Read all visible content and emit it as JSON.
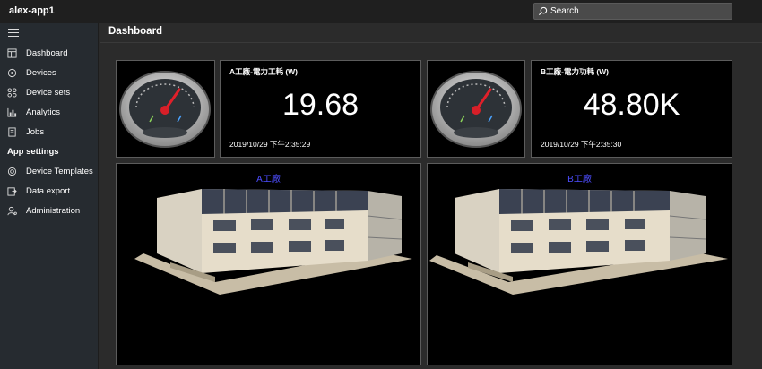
{
  "app": {
    "name": "alex-app1"
  },
  "search": {
    "placeholder": "Search"
  },
  "sidebar": {
    "items": [
      {
        "label": "Dashboard",
        "icon": "dashboard-icon"
      },
      {
        "label": "Devices",
        "icon": "devices-icon"
      },
      {
        "label": "Device sets",
        "icon": "device-sets-icon"
      },
      {
        "label": "Analytics",
        "icon": "analytics-icon"
      },
      {
        "label": "Jobs",
        "icon": "jobs-icon"
      }
    ],
    "section_heading": "App settings",
    "settings_items": [
      {
        "label": "Device Templates",
        "icon": "device-templates-icon"
      },
      {
        "label": "Data export",
        "icon": "data-export-icon"
      },
      {
        "label": "Administration",
        "icon": "administration-icon"
      }
    ]
  },
  "page": {
    "title": "Dashboard"
  },
  "tiles": [
    {
      "title": "A工廠-電力工耗 (W)",
      "value": "19.68",
      "timestamp": "2019/10/29 下午2:35:29"
    },
    {
      "title": "B工廠-電力功耗 (W)",
      "value": "48.80K",
      "timestamp": "2019/10/29 下午2:35:30"
    }
  ],
  "buildings": [
    {
      "title": "A工廠"
    },
    {
      "title": "B工廠"
    }
  ],
  "colors": {
    "background": "#2b2b2b",
    "topbar": "#1f1f1f",
    "sidebar": "#262b30",
    "tile": "#000000",
    "building_title": "#4d4dff"
  }
}
